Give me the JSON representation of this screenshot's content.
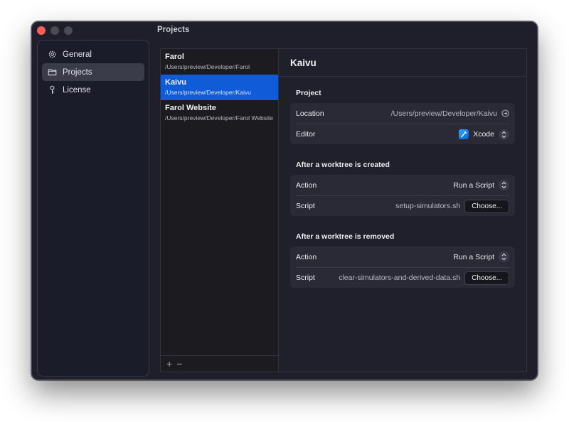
{
  "window": {
    "title": "Projects"
  },
  "sidebar": {
    "items": [
      {
        "label": "General",
        "icon": "gear-icon"
      },
      {
        "label": "Projects",
        "icon": "folder-icon",
        "active": true
      },
      {
        "label": "License",
        "icon": "key-icon"
      }
    ]
  },
  "projects": [
    {
      "name": "Farol",
      "path": "/Users/preview/Developer/Farol"
    },
    {
      "name": "Kaivu",
      "path": "/Users/preview/Developer/Kaivu",
      "selected": true
    },
    {
      "name": "Farol Website",
      "path": "/Users/preview/Developer/Farol Website"
    }
  ],
  "list_footer": {
    "add": "+",
    "remove": "−"
  },
  "detail": {
    "title": "Kaivu",
    "project_section": {
      "title": "Project",
      "location_label": "Location",
      "location_value": "/Users/preview/Developer/Kaivu",
      "editor_label": "Editor",
      "editor_value": "Xcode"
    },
    "created_section": {
      "title": "After a worktree is created",
      "action_label": "Action",
      "action_value": "Run a Script",
      "script_label": "Script",
      "script_value": "setup-simulators.sh",
      "choose_label": "Choose..."
    },
    "removed_section": {
      "title": "After a worktree is removed",
      "action_label": "Action",
      "action_value": "Run a Script",
      "script_label": "Script",
      "script_value": "clear-simulators-and-derived-data.sh",
      "choose_label": "Choose..."
    }
  },
  "colors": {
    "accent": "#0f5bd8",
    "window_bg": "#1f1f2b",
    "close_button": "#ff5f57"
  }
}
